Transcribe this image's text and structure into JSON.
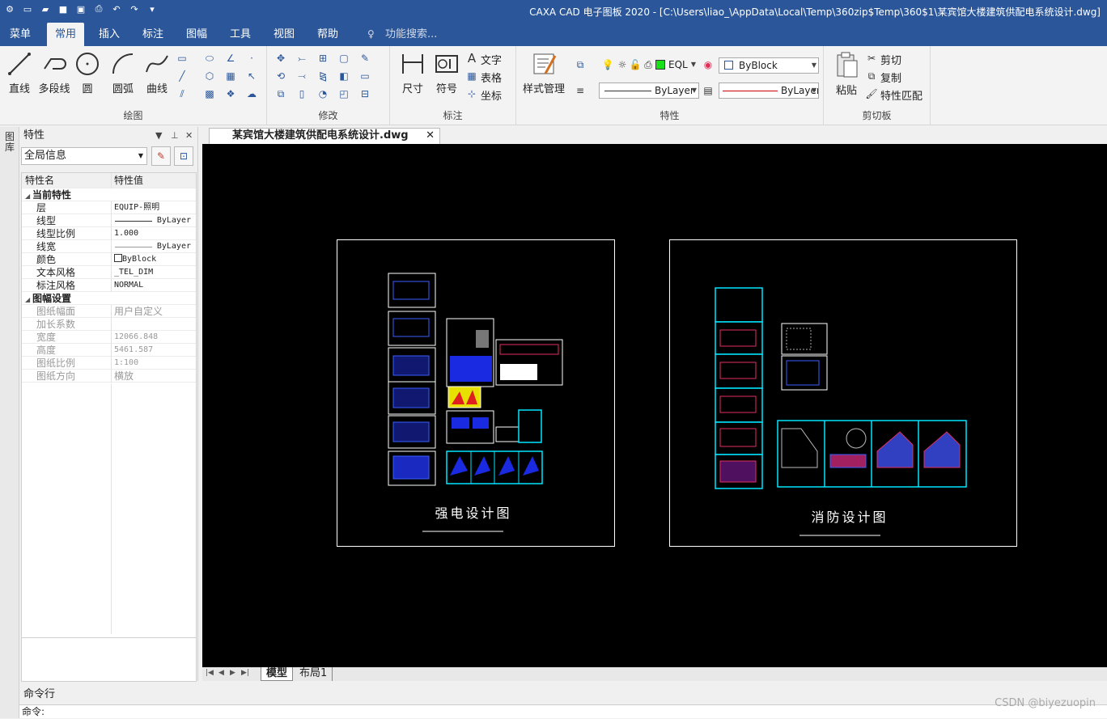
{
  "window": {
    "title": "CAXA CAD 电子图板 2020 - [C:\\Users\\liao_\\AppData\\Local\\Temp\\360zip$Temp\\360$1\\某宾馆大楼建筑供配电系统设计.dwg]"
  },
  "ribbon_tabs": [
    "菜单",
    "常用",
    "插入",
    "标注",
    "图幅",
    "工具",
    "视图",
    "帮助"
  ],
  "search_placeholder": "功能搜索...",
  "ribbon": {
    "draw": {
      "label": "绘图",
      "line": "直线",
      "polyline": "多段线",
      "circle": "圆",
      "arc": "圆弧",
      "curve": "曲线"
    },
    "modify": {
      "label": "修改"
    },
    "annotate": {
      "label": "标注",
      "dimension": "尺寸",
      "symbol": "符号",
      "text": "文字",
      "table": "表格",
      "coord": "坐标"
    },
    "properties": {
      "label": "特性",
      "style_mgr": "样式管理",
      "layer": "EQL",
      "color": "ByBlock",
      "linetype": "ByLayer",
      "lineweight": "ByLayer"
    },
    "clipboard": {
      "label": "剪切板",
      "paste": "粘贴",
      "cut": "剪切",
      "copy": "复制",
      "match": "特性匹配"
    }
  },
  "left_strip": {
    "vtab": "图库"
  },
  "props_panel": {
    "title": "特性",
    "combo": "全局信息",
    "col_name": "特性名",
    "col_value": "特性值",
    "sec_current": "当前特性",
    "rows_current": [
      {
        "k": "层",
        "v": "EQUIP-照明"
      },
      {
        "k": "线型",
        "v": "ByLayer"
      },
      {
        "k": "线型比例",
        "v": "1.000"
      },
      {
        "k": "线宽",
        "v": "ByLayer"
      },
      {
        "k": "颜色",
        "v": "ByBlock"
      },
      {
        "k": "文本风格",
        "v": "_TEL_DIM"
      },
      {
        "k": "标注风格",
        "v": "NORMAL"
      }
    ],
    "sec_sheet": "图幅设置",
    "rows_sheet": [
      {
        "k": "图纸幅面",
        "v": "用户自定义"
      },
      {
        "k": "加长系数",
        "v": ""
      },
      {
        "k": "宽度",
        "v": "12066.848"
      },
      {
        "k": "高度",
        "v": "5461.587"
      },
      {
        "k": "图纸比例",
        "v": "1:100"
      },
      {
        "k": "图纸方向",
        "v": "横放"
      }
    ]
  },
  "doc_tab": "某宾馆大楼建筑供配电系统设计.dwg",
  "drawing": {
    "left_title": "强电设计图",
    "right_title": "消防设计图"
  },
  "layout_tabs": [
    "模型",
    "布局1"
  ],
  "command": {
    "title": "命令行",
    "prompt": "命令:"
  },
  "watermark": "CSDN @biyezuopin"
}
